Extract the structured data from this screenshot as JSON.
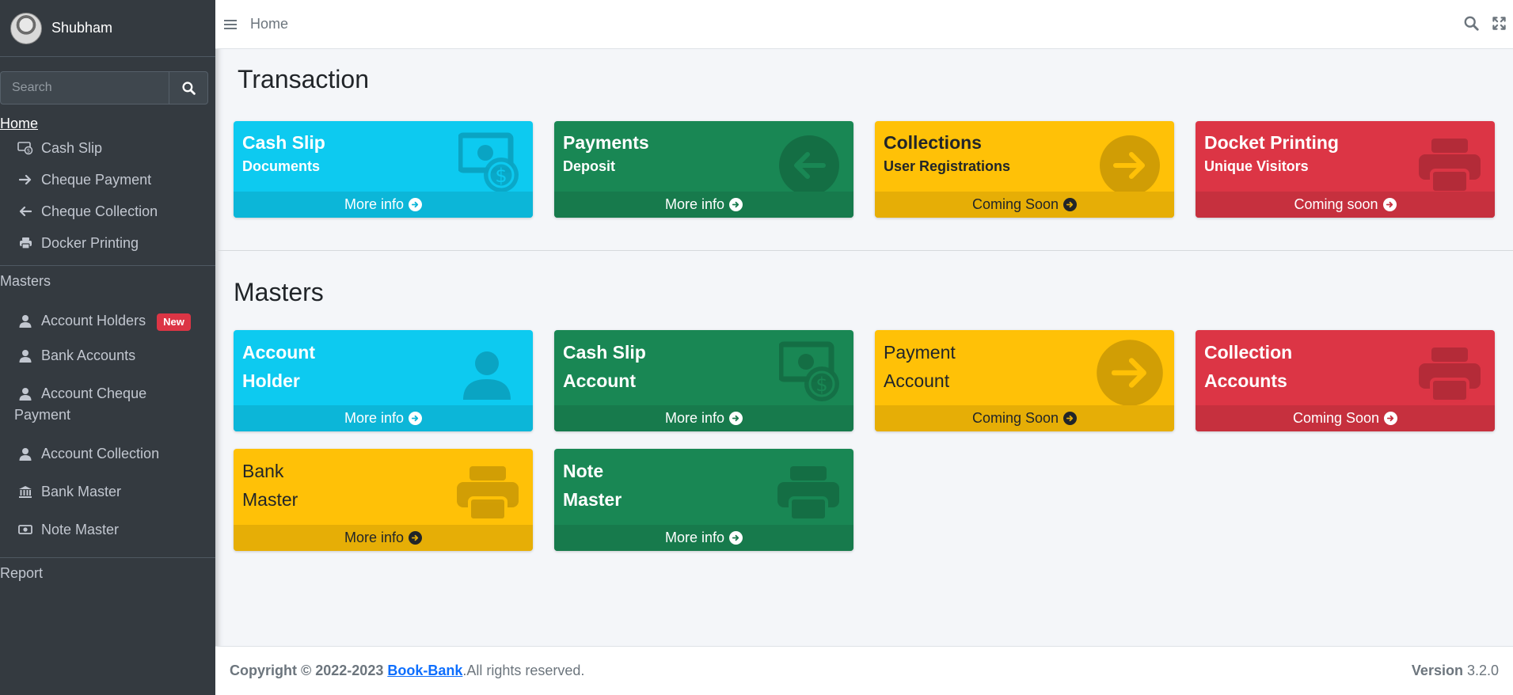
{
  "user": {
    "name": "Shubham"
  },
  "sidebar": {
    "search_placeholder": "Search",
    "home_label": "Home",
    "home_items": [
      {
        "label": "Cash Slip",
        "icon": "cash-slip-icon"
      },
      {
        "label": "Cheque Payment",
        "icon": "arrow-right-icon"
      },
      {
        "label": "Cheque Collection",
        "icon": "arrow-left-icon"
      },
      {
        "label": "Docker Printing",
        "icon": "printer-icon"
      }
    ],
    "masters_header": "Masters",
    "masters_items": [
      {
        "label": "Account Holders",
        "icon": "user-icon",
        "badge": "New"
      },
      {
        "label": "Bank Accounts",
        "icon": "user-icon"
      },
      {
        "label": "Account Cheque Payment",
        "label_line1": "Account Cheque",
        "label_line2": "Payment",
        "icon": "user-icon"
      },
      {
        "label": "Account Collection",
        "icon": "user-icon"
      },
      {
        "label": "Bank Master",
        "icon": "bank-icon"
      },
      {
        "label": "Note Master",
        "icon": "money-note-icon"
      }
    ],
    "report_header": "Report"
  },
  "topbar": {
    "breadcrumb": "Home"
  },
  "transaction": {
    "title": "Transaction",
    "boxes": [
      {
        "title": "Cash Slip",
        "subtitle": "Documents",
        "footer": "More info",
        "color": "#0dcaf0"
      },
      {
        "title": "Payments",
        "subtitle": "Deposit",
        "footer": "More info",
        "color": "#198754"
      },
      {
        "title": "Collections",
        "subtitle": "User Registrations",
        "footer": "Coming Soon",
        "color": "#ffc107"
      },
      {
        "title": "Docket Printing",
        "subtitle": "Unique Visitors",
        "footer": "Coming soon",
        "color": "#dc3545"
      }
    ]
  },
  "masters": {
    "title": "Masters",
    "boxes": [
      {
        "line1": "Account",
        "line2": "Holder",
        "footer": "More info",
        "color": "#0dcaf0"
      },
      {
        "line1": "Cash Slip",
        "line2": "Account",
        "footer": "More info",
        "color": "#198754"
      },
      {
        "line1": "Payment",
        "line2": "Account",
        "footer": "Coming Soon",
        "color": "#ffc107"
      },
      {
        "line1": "Collection",
        "line2": "Accounts",
        "footer": "Coming Soon",
        "color": "#dc3545"
      },
      {
        "line1": "Bank",
        "line2": "Master",
        "footer": "More info",
        "color": "#ffc107"
      },
      {
        "line1": "Note",
        "line2": "Master",
        "footer": "More info",
        "color": "#198754"
      }
    ]
  },
  "footer": {
    "copyright": "Copyright © 2022-2023 ",
    "brand": "Book-Bank",
    "rights": ".All rights reserved.",
    "version_label": "Version",
    "version_value": " 3.2.0"
  }
}
